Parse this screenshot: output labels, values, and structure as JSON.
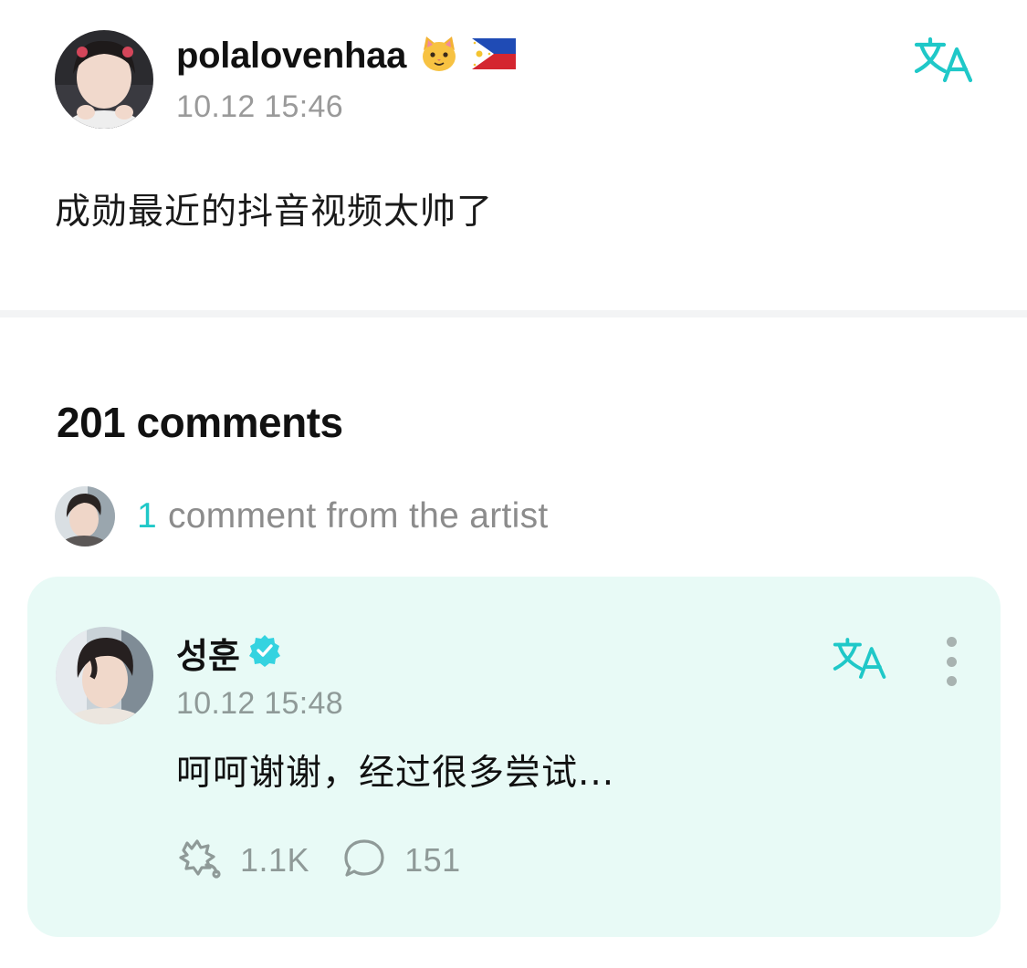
{
  "post": {
    "author": "polalovenhaa",
    "author_emojis": [
      "cat-face",
      "philippines-flag"
    ],
    "time": "10.12 15:46",
    "text": "成勋最近的抖音视频太帅了",
    "translate_icon": "translate-icon"
  },
  "comments": {
    "count_label": "201 comments",
    "artist_summary": {
      "count": "1",
      "label": "comment from the artist"
    }
  },
  "artist_comment": {
    "author": "성훈",
    "verified": true,
    "time": "10.12 15:48",
    "text": "呵呵谢谢，经过很多尝试...",
    "likes": "1.1K",
    "replies": "151"
  },
  "colors": {
    "accent": "#1fc8c8",
    "card_background": "#e8faf6",
    "muted_text": "#8f9a98",
    "divider": "#f3f4f5"
  }
}
